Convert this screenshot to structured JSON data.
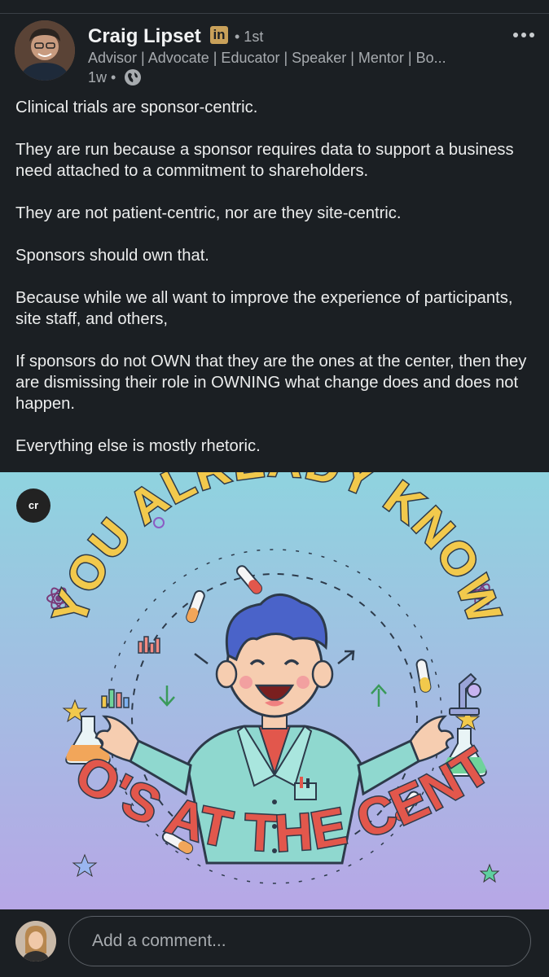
{
  "post": {
    "author": {
      "name": "Craig Lipset",
      "badge": "in",
      "degree": "• 1st",
      "headline": "Advisor | Advocate | Educator | Speaker | Mentor | Bo...",
      "time": "1w •"
    },
    "body": [
      "Clinical trials are sponsor-centric.",
      "They are run because a sponsor requires data to support a business need attached to a commitment to shareholders.",
      "They are not patient-centric, nor are they site-centric.",
      "Sponsors should own that.",
      "Because while we all want to improve the experience of participants, site staff, and others,",
      "If sponsors do not OWN that they are the ones at the center, then they are dismissing their role in OWNING what change does and does not happen.",
      "Everything else is mostly rhetoric."
    ],
    "image": {
      "badge": "cr",
      "top_text": "YOU ALREADY KNOW",
      "bottom_text": "WHO'S AT THE CENTER"
    }
  },
  "comment": {
    "placeholder": "Add a comment..."
  },
  "colors": {
    "background": "#1b1f23",
    "muted_text": "#a7abaf",
    "image_sky_top": "#8fd3df",
    "image_sky_bottom": "#b7a7e6"
  }
}
